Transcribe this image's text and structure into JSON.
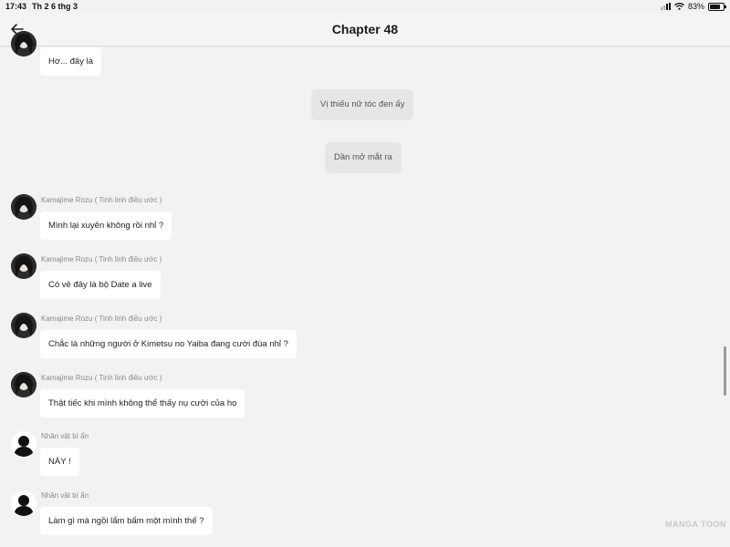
{
  "status": {
    "time": "17:43",
    "date": "Th 2 6 thg 3",
    "battery": "83%"
  },
  "header": {
    "title": "Chapter 48"
  },
  "messages": [
    {
      "type": "bubble",
      "text": "Hơ... đây là"
    },
    {
      "type": "narration",
      "text": "Vị thiếu nữ tóc đen ấy"
    },
    {
      "type": "narration",
      "text": "Dần mở mắt ra"
    },
    {
      "type": "bubble",
      "sender": "Kamajime Rozu ( Tinh linh điều ước )",
      "text": "Mình lại xuyên không rồi nhỉ ?"
    },
    {
      "type": "bubble",
      "sender": "Kamajime Rozu ( Tinh linh điều ước )",
      "text": "Có vẻ đây là bộ Date a live"
    },
    {
      "type": "bubble",
      "sender": "Kamajime Rozu ( Tinh linh điều ước )",
      "text": "Chắc là những người ở Kimetsu no Yaiba đang cười đùa nhỉ ?"
    },
    {
      "type": "bubble",
      "sender": "Kamajime Rozu ( Tinh linh điều ước )",
      "text": "Thật tiếc khi mình không thể thấy nụ cười của họ"
    },
    {
      "type": "bubble",
      "sender": "Nhân vật bí ẩn",
      "text": "NÀY !"
    },
    {
      "type": "bubble",
      "sender": "Nhân vật bí ẩn",
      "text": "Làm gì mà ngồi lẩm bẩm một mình thế ?"
    }
  ],
  "watermark": "MANGA TOON"
}
